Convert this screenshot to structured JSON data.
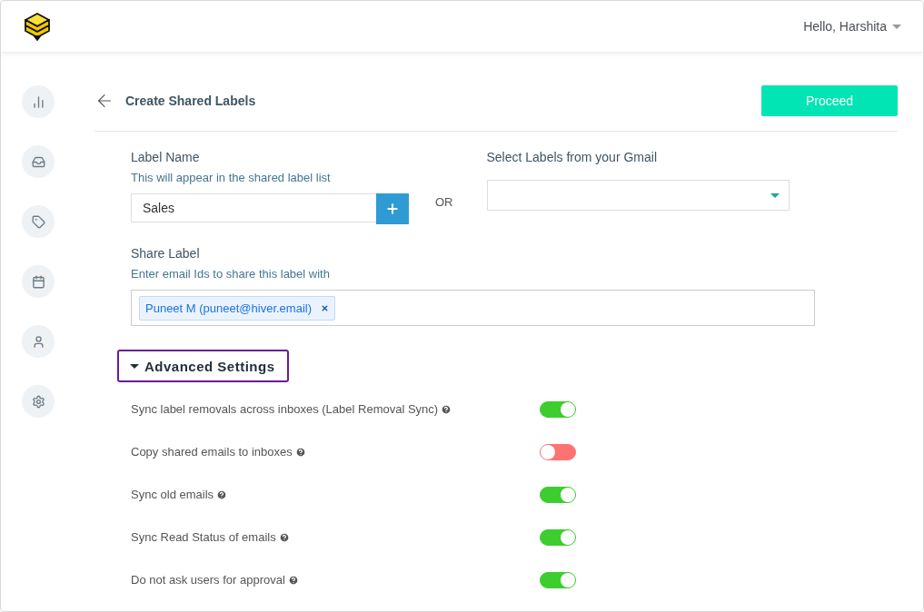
{
  "header": {
    "greeting": "Hello, Harshita"
  },
  "sidebar": {
    "items": [
      {
        "kind": "stats",
        "selected": false
      },
      {
        "kind": "inbox",
        "selected": false
      },
      {
        "kind": "tag",
        "selected": false
      },
      {
        "kind": "calendar",
        "selected": false
      },
      {
        "kind": "user",
        "selected": false
      },
      {
        "kind": "settings",
        "selected": false
      }
    ]
  },
  "page": {
    "title": "Create Shared Labels",
    "proceed_button": "Proceed"
  },
  "label_name": {
    "label": "Label Name",
    "hint": "This will appear in the shared label list",
    "value": "Sales"
  },
  "separator": "OR",
  "gmail_labels": {
    "label": "Select Labels from your Gmail"
  },
  "share_label": {
    "label": "Share Label",
    "hint": "Enter email Ids to share this label with",
    "chips": [
      "Puneet M (puneet@hiver.email)"
    ]
  },
  "advanced": {
    "title": "Advanced Settings",
    "expanded": true,
    "settings": [
      {
        "label": "Sync label removals across inboxes (Label Removal Sync)",
        "on": true
      },
      {
        "label": "Copy shared emails to inboxes",
        "on": false
      },
      {
        "label": "Sync old emails",
        "on": true
      },
      {
        "label": "Sync Read Status of emails",
        "on": true
      },
      {
        "label": "Do not ask users for approval",
        "on": true
      }
    ]
  }
}
